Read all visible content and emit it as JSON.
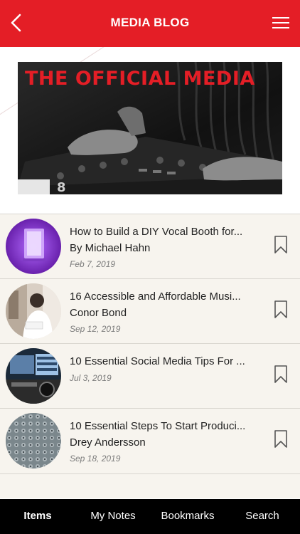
{
  "header": {
    "title": "MEDIA BLOG",
    "back_icon": "chevron-left-icon",
    "menu_icon": "hamburger-menu-icon",
    "background": "#e41e26"
  },
  "banner": {
    "text": "THE OFFICIAL MEDIA",
    "text_color": "#e41e26"
  },
  "articles": [
    {
      "title": "How to Build a DIY Vocal Booth for...",
      "author": "By Michael Hahn",
      "date": "Feb 7, 2019",
      "bookmark_icon": "bookmark-icon"
    },
    {
      "title": "16 Accessible and Affordable Musi...",
      "author": "Conor Bond",
      "date": "Sep 12, 2019",
      "bookmark_icon": "bookmark-icon"
    },
    {
      "title": "10 Essential Social Media Tips For ...",
      "author": "",
      "date": "Jul 3, 2019",
      "bookmark_icon": "bookmark-icon"
    },
    {
      "title": "10 Essential Steps To Start Produci...",
      "author": "Drey Andersson",
      "date": "Sep 18, 2019",
      "bookmark_icon": "bookmark-icon"
    }
  ],
  "tabs": [
    {
      "label": "Items",
      "active": true
    },
    {
      "label": "My Notes",
      "active": false
    },
    {
      "label": "Bookmarks",
      "active": false
    },
    {
      "label": "Search",
      "active": false
    }
  ]
}
